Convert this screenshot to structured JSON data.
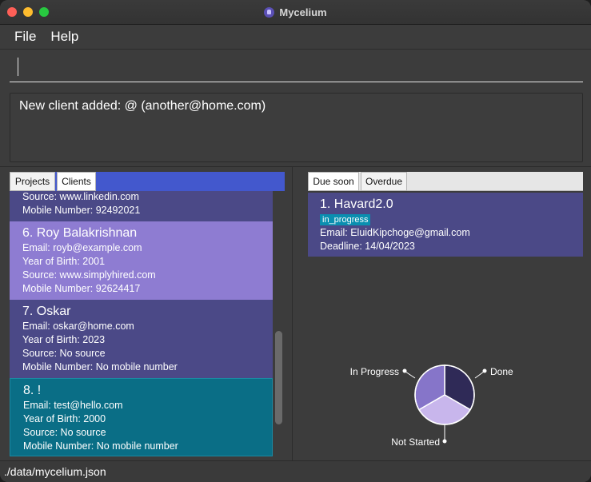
{
  "window": {
    "title": "Mycelium",
    "app_icon": "mushroom-icon"
  },
  "menu": {
    "file": "File",
    "help": "Help"
  },
  "command": {
    "value": "",
    "placeholder": ""
  },
  "result": {
    "message": "New client added: @ (another@home.com)"
  },
  "left_tabs": {
    "projects": "Projects",
    "clients": "Clients",
    "selected": "Clients"
  },
  "clients": [
    {
      "source": "Source: www.linkedin.com",
      "mobile": "Mobile Number: 92492021"
    },
    {
      "name": "6.  Roy Balakrishnan",
      "email": "Email: royb@example.com",
      "year": "Year of Birth: 2001",
      "source": "Source: www.simplyhired.com",
      "mobile": "Mobile Number: 92624417"
    },
    {
      "name": "7.  Oskar",
      "email": "Email: oskar@home.com",
      "year": "Year of Birth: 2023",
      "source": "Source: No source",
      "mobile": "Mobile Number: No mobile number"
    },
    {
      "name": "8.  !",
      "email": "Email: test@hello.com",
      "year": "Year of Birth: 2000",
      "source": "Source: No source",
      "mobile": "Mobile Number: No mobile number"
    }
  ],
  "right_tabs": {
    "due_soon": "Due soon",
    "overdue": "Overdue",
    "selected": "Due soon"
  },
  "projects": [
    {
      "name": "1.  Havard2.0",
      "status": "in_progress",
      "email": "Email: EluidKipchoge@gmail.com",
      "deadline": "Deadline: 14/04/2023"
    }
  ],
  "chart_data": {
    "type": "pie",
    "slices": [
      {
        "label": "Done",
        "value": 1,
        "color": "#2f2a57"
      },
      {
        "label": "Not Started",
        "value": 1,
        "color": "#c8b6ec"
      },
      {
        "label": "In Progress",
        "value": 1,
        "color": "#8675c9"
      }
    ]
  },
  "status_bar": {
    "path": "./data/mycelium.json"
  },
  "colors": {
    "tab_bar_accent": "#4358cd",
    "card_dark": "#4b4987",
    "card_selected": "#8e7cd2",
    "card_teal": "#0a6e86",
    "badge": "#0a8fb0"
  }
}
